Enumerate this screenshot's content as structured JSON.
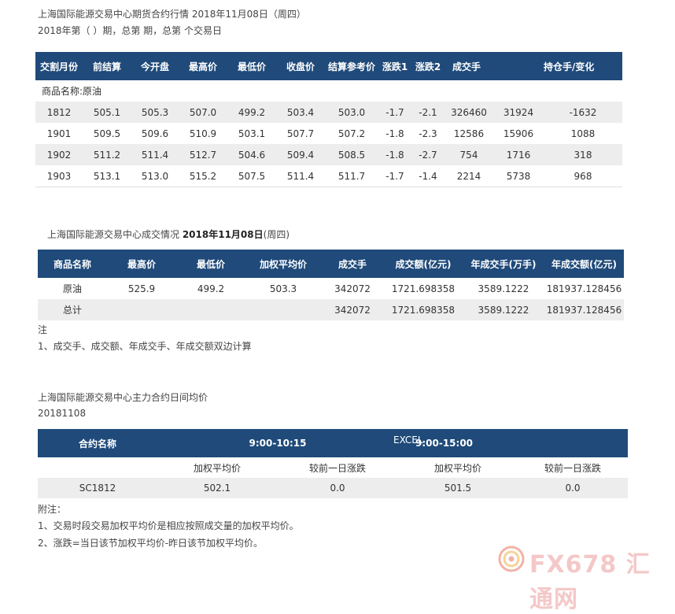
{
  "heading1": "上海国际能源交易中心期货合约行情 2018年11月08日（周四）",
  "heading2": "2018年第（ ）期，总第 期，总第 个交易日",
  "table1": {
    "headers": [
      "交割月份",
      "前结算",
      "今开盘",
      "最高价",
      "最低价",
      "收盘价",
      "结算参考价",
      "涨跌1",
      "涨跌2",
      "成交手",
      "",
      "持仓手/变化"
    ],
    "category": "商品名称:原油",
    "rows": [
      [
        "1812",
        "505.1",
        "505.3",
        "507.0",
        "499.2",
        "503.4",
        "503.0",
        "-1.7",
        "-2.1",
        "326460",
        "31924",
        "-1632"
      ],
      [
        "1901",
        "509.5",
        "509.6",
        "510.9",
        "503.1",
        "507.7",
        "507.2",
        "-1.8",
        "-2.3",
        "12586",
        "15906",
        "1088"
      ],
      [
        "1902",
        "511.2",
        "511.4",
        "512.7",
        "504.6",
        "509.4",
        "508.5",
        "-1.8",
        "-2.7",
        "754",
        "1716",
        "318"
      ],
      [
        "1903",
        "513.1",
        "513.0",
        "515.2",
        "507.5",
        "511.4",
        "511.7",
        "-1.7",
        "-1.4",
        "2214",
        "5738",
        "968"
      ]
    ]
  },
  "heading3_normal": "上海国际能源交易中心成交情况 ",
  "heading3_bold": "2018年11月08日",
  "heading3_tail": "(周四)",
  "table2": {
    "headers": [
      "商品名称",
      "最高价",
      "最低价",
      "加权平均价",
      "成交手",
      "成交额(亿元)",
      "年成交手(万手)",
      "年成交额(亿元)"
    ],
    "rows": [
      [
        "原油",
        "525.9",
        "499.2",
        "503.3",
        "342072",
        "1721.698358",
        "3589.1222",
        "181937.128456"
      ],
      [
        "总计",
        "",
        "",
        "",
        "342072",
        "1721.698358",
        "3589.1222",
        "181937.128456"
      ]
    ]
  },
  "note_label": "注",
  "note1": "1、成交手、成交额、年成交手、年成交额双边计算",
  "heading4": "上海国际能源交易中心主力合约日间均价",
  "heading5": "20181108",
  "table3": {
    "headers": [
      "合约名称",
      "9:00-10:15",
      "9:00-15:00"
    ],
    "excel": "EXCEL",
    "subheaders": [
      "",
      "加权平均价",
      "较前一日涨跌",
      "加权平均价",
      "较前一日涨跌"
    ],
    "row": [
      "SC1812",
      "502.1",
      "0.0",
      "501.5",
      "0.0"
    ]
  },
  "footnote_label": "附注：",
  "footnote1": "1、交易时段交易加权平均价是相应按照成交量的加权平均价。",
  "footnote2": "2、涨跌=当日该节加权平均价-昨日该节加权平均价。",
  "watermark": "FX678 汇通网",
  "colors": {
    "header_bg": "#1f4a7a",
    "row_alt": "#ededed"
  }
}
